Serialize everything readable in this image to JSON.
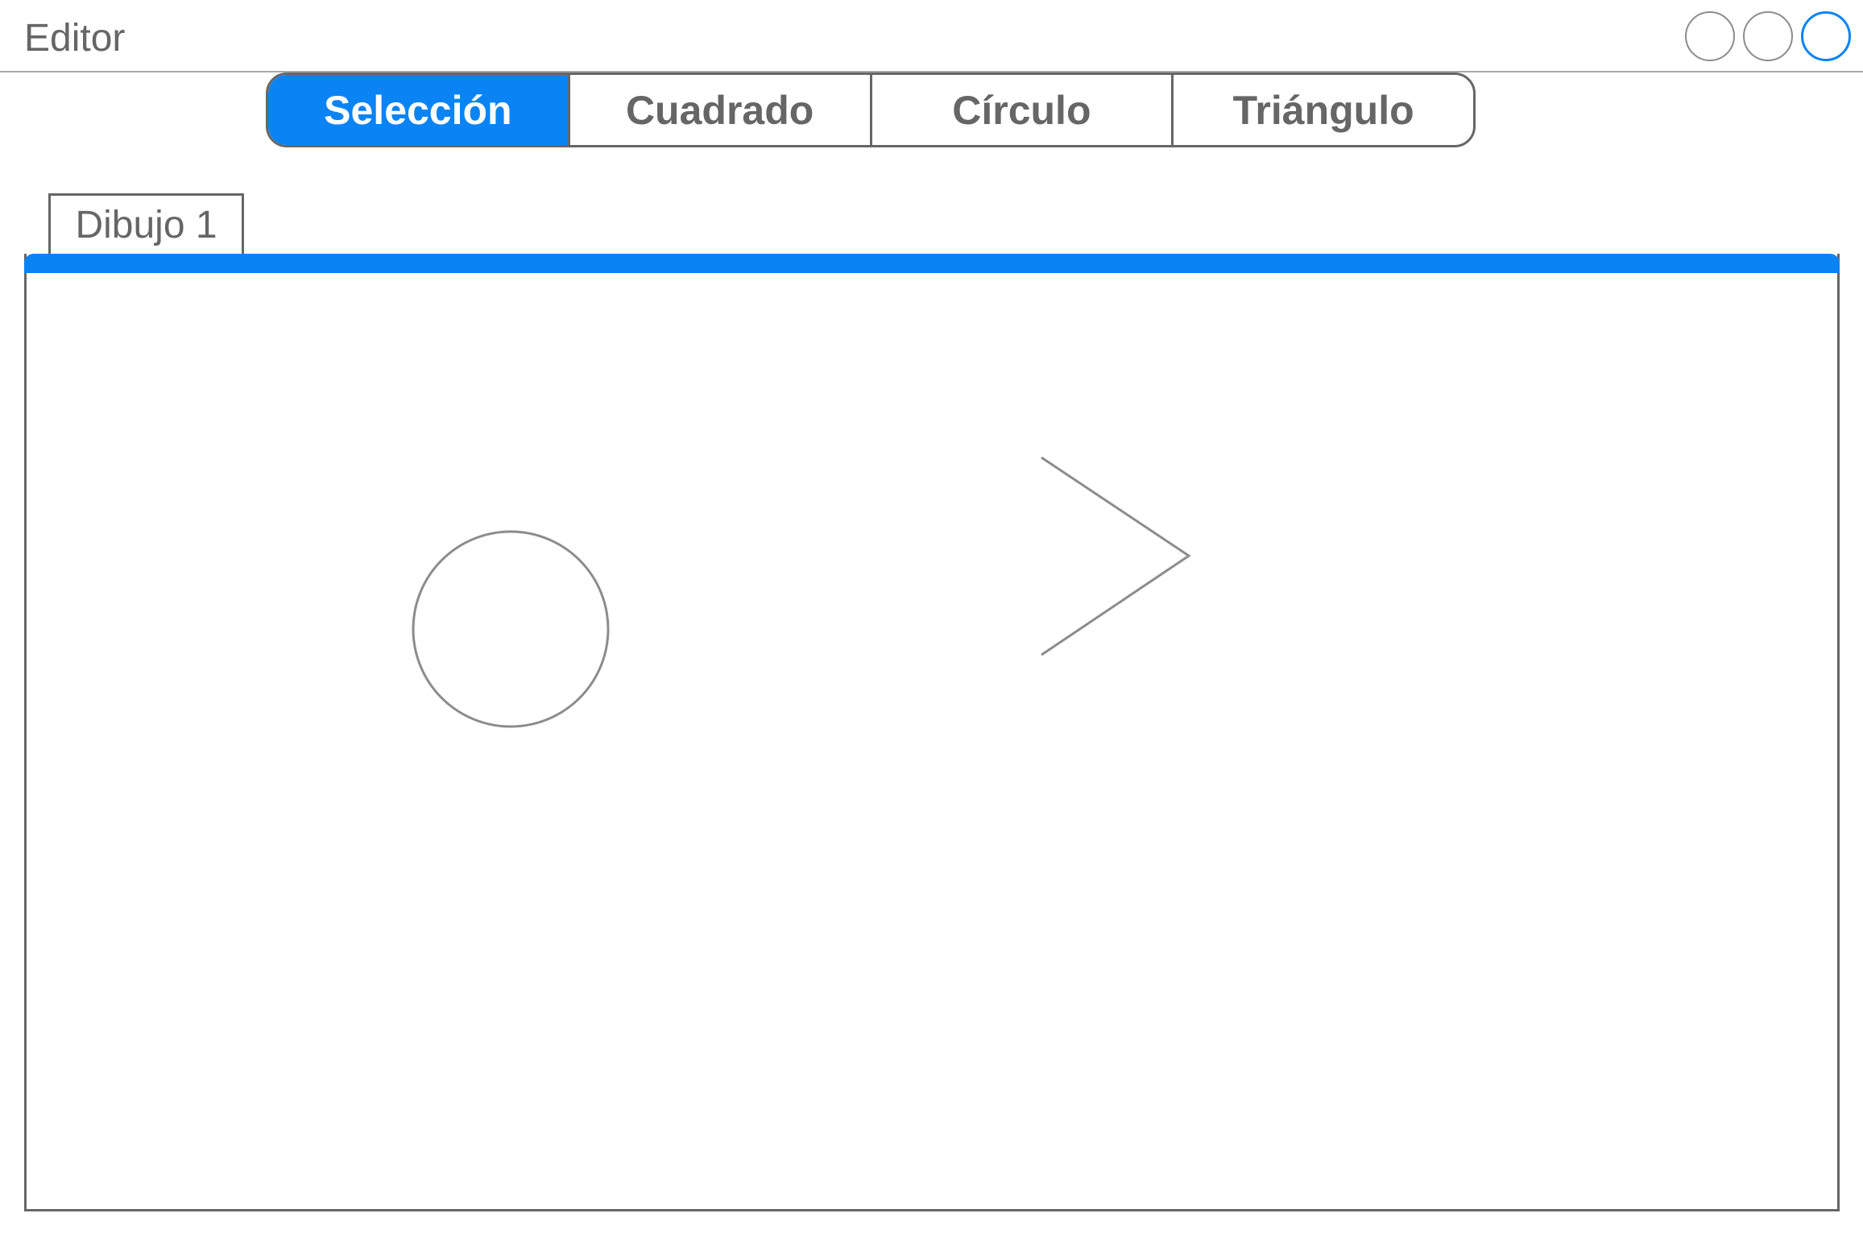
{
  "window": {
    "title": "Editor",
    "controls": [
      "minimize-icon",
      "maximize-icon",
      "close-icon"
    ],
    "accent_color": "#0a84f5"
  },
  "toolbar": {
    "tools": [
      {
        "label": "Selección",
        "selected": true
      },
      {
        "label": "Cuadrado",
        "selected": false
      },
      {
        "label": "Círculo",
        "selected": false
      },
      {
        "label": "Triángulo",
        "selected": false
      }
    ]
  },
  "document": {
    "tab_label": "Dibujo 1",
    "shapes": [
      {
        "type": "circle"
      },
      {
        "type": "chevron"
      }
    ]
  }
}
